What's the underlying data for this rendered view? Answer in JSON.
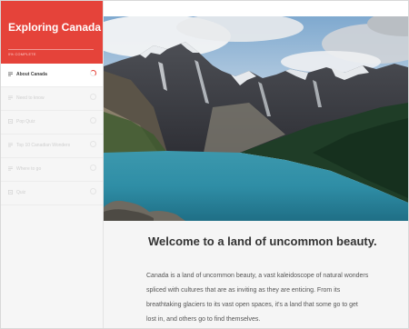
{
  "course": {
    "title": "Exploring Canada",
    "progress_label": "0% COMPLETE",
    "progress_fraction": 0
  },
  "lessons": [
    {
      "label": "About Canada",
      "icon": "text-lines-icon",
      "active": true
    },
    {
      "label": "Need to know",
      "icon": "text-lines-icon",
      "active": false
    },
    {
      "label": "Pop Quiz",
      "icon": "quiz-icon",
      "active": false
    },
    {
      "label": "Top 10 Canadian Wonders",
      "icon": "text-lines-icon",
      "active": false
    },
    {
      "label": "Where to go",
      "icon": "text-lines-icon",
      "active": false
    },
    {
      "label": "Quiz",
      "icon": "quiz-icon",
      "active": false
    }
  ],
  "lesson": {
    "title": "Welcome to a land of uncommon beauty.",
    "body": "Canada is a land of uncommon beauty, a vast kaleidoscope of natural wonders spliced with cultures that are as inviting as they are enticing. From its breathtaking glaciers to its vast open spaces, it's a land that some go to get lost in, and others go to find themselves."
  },
  "colors": {
    "accent": "#e5433a",
    "sidebar_bg": "#f6f6f6",
    "active_text": "#444444",
    "inactive_text": "#cfcfcf"
  }
}
